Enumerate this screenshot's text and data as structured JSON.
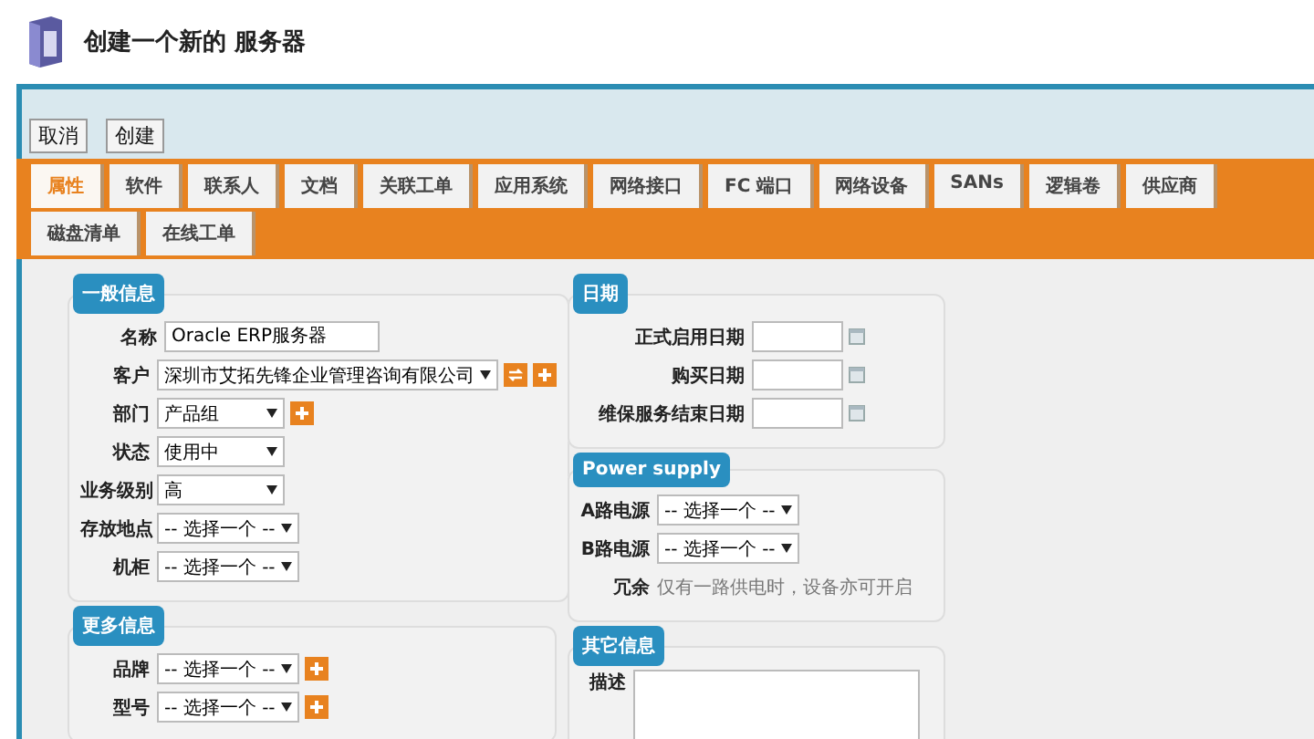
{
  "window": {
    "title": "创建一个新的 服务器"
  },
  "toolbar": {
    "buttons": [
      "取消",
      "创建"
    ]
  },
  "tabs": [
    {
      "label": "属性",
      "selected": true
    },
    {
      "label": "软件",
      "selected": false
    },
    {
      "label": "联系人",
      "selected": false
    },
    {
      "label": "文档",
      "selected": false
    },
    {
      "label": "关联工单",
      "selected": false
    },
    {
      "label": "应用系统",
      "selected": false
    },
    {
      "label": "网络接口",
      "selected": false
    },
    {
      "label": "FC 端口",
      "selected": false
    },
    {
      "label": "网络设备",
      "selected": false
    },
    {
      "label": "SANs",
      "selected": false
    },
    {
      "label": "逻辑卷",
      "selected": false
    },
    {
      "label": "供应商",
      "selected": false
    },
    {
      "label": "磁盘清单",
      "selected": false
    },
    {
      "label": "在线工单",
      "selected": false
    }
  ],
  "left_column": [
    {
      "legend": "一般信息",
      "rows": [
        {
          "label": "名称",
          "kind": "text",
          "value": "Oracle ERP服务器"
        },
        {
          "label": "客户",
          "kind": "select",
          "value": "深圳市艾拓先锋企业管理咨询有限公司",
          "buttons": [
            {
              "kind": "refresh"
            },
            {
              "kind": "add"
            }
          ]
        },
        {
          "label": "部门",
          "kind": "select",
          "value": "产品组",
          "buttons": [
            {
              "kind": "add"
            }
          ]
        },
        {
          "label": "状态",
          "kind": "select",
          "value": "使用中"
        },
        {
          "label": "业务级别",
          "kind": "select",
          "value": "高"
        },
        {
          "label": "存放地点",
          "kind": "select",
          "value": "-- 选择一个 --"
        },
        {
          "label": "机柜",
          "kind": "select",
          "value": "-- 选择一个 --"
        }
      ]
    },
    {
      "legend": "更多信息",
      "rows": [
        {
          "label": "品牌",
          "kind": "select",
          "value": "-- 选择一个 --",
          "buttons": [
            {
              "kind": "add"
            }
          ]
        },
        {
          "label": "型号",
          "kind": "select",
          "value": "-- 选择一个 --",
          "buttons": [
            {
              "kind": "add"
            }
          ]
        }
      ]
    }
  ],
  "right_column": [
    {
      "legend": "日期",
      "rows": [
        {
          "label": "正式启用日期",
          "kind": "date"
        },
        {
          "label": "购买日期",
          "kind": "date"
        },
        {
          "label": "维保服务结束日期",
          "kind": "date"
        }
      ]
    },
    {
      "legend": "Power supply",
      "rows": [
        {
          "label": "A路电源",
          "kind": "select",
          "value": "-- 选择一个 --"
        },
        {
          "label": "B路电源",
          "kind": "select",
          "value": "-- 选择一个 --"
        },
        {
          "label": "冗余",
          "kind": "note",
          "value": "仅有一路供电时，设备亦可开启"
        }
      ]
    },
    {
      "legend": "其它信息",
      "rows": [
        {
          "label": "描述",
          "kind": "textarea"
        }
      ]
    }
  ]
}
